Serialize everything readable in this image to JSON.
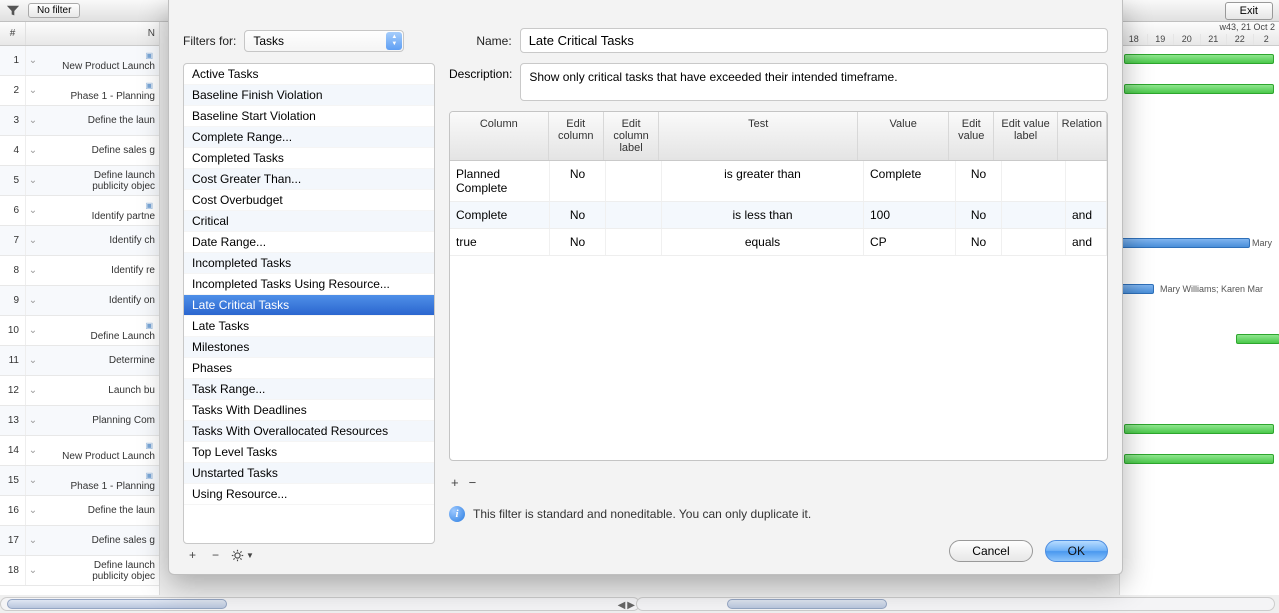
{
  "toolbar": {
    "no_filter": "No filter",
    "exit": "Exit"
  },
  "left": {
    "col_num": "#",
    "col_name": "N",
    "rows": [
      {
        "n": "1",
        "txt": "New Product Launch",
        "disc": true
      },
      {
        "n": "2",
        "txt": "Phase 1 - Planning",
        "disc": true
      },
      {
        "n": "3",
        "txt": "Define the laun"
      },
      {
        "n": "4",
        "txt": "Define sales g"
      },
      {
        "n": "5",
        "txt": "Define launch\npublicity objec"
      },
      {
        "n": "6",
        "txt": "Identify partne",
        "disc": true
      },
      {
        "n": "7",
        "txt": "Identify ch"
      },
      {
        "n": "8",
        "txt": "Identify re"
      },
      {
        "n": "9",
        "txt": "Identify on"
      },
      {
        "n": "10",
        "txt": "Define Launch",
        "disc": true
      },
      {
        "n": "11",
        "txt": "Determine"
      },
      {
        "n": "12",
        "txt": "Launch bu"
      },
      {
        "n": "13",
        "txt": "Planning Com"
      },
      {
        "n": "14",
        "txt": "New Product Launch",
        "disc": true
      },
      {
        "n": "15",
        "txt": "Phase 1 - Planning",
        "disc": true
      },
      {
        "n": "16",
        "txt": "Define the laun"
      },
      {
        "n": "17",
        "txt": "Define sales g"
      },
      {
        "n": "18",
        "txt": "Define launch\npublicity objec"
      }
    ]
  },
  "gantt": {
    "week_label": "w43, 21 Oct 2",
    "days": [
      "18",
      "19",
      "20",
      "21",
      "22",
      "2"
    ],
    "labels": [
      "Mary",
      "Mary Williams; Karen Mar"
    ]
  },
  "dialog": {
    "filters_for_label": "Filters for:",
    "filters_for_value": "Tasks",
    "name_label": "Name:",
    "name_value": "Late Critical Tasks",
    "description_label": "Description:",
    "description_value": "Show only critical tasks that have exceeded their intended timeframe.",
    "filter_list": [
      "Active Tasks",
      "Baseline Finish Violation",
      "Baseline Start Violation",
      "Complete Range...",
      "Completed Tasks",
      "Cost Greater Than...",
      "Cost Overbudget",
      "Critical",
      "Date Range...",
      "Incompleted Tasks",
      "Incompleted Tasks Using Resource...",
      "Late Critical Tasks",
      "Late Tasks",
      "Milestones",
      "Phases",
      "Task Range...",
      "Tasks With Deadlines",
      "Tasks With Overallocated Resources",
      "Top Level Tasks",
      "Unstarted Tasks",
      "Using Resource..."
    ],
    "selected_filter": "Late Critical Tasks",
    "table": {
      "headers": {
        "column": "Column",
        "edit_column": "Edit column",
        "edit_column_label": "Edit column label",
        "test": "Test",
        "value": "Value",
        "edit_value": "Edit value",
        "edit_value_label": "Edit value label",
        "relation": "Relation"
      },
      "rows": [
        {
          "column": "Planned Complete",
          "edit_column": "No",
          "edit_column_label": "",
          "test": "is greater than",
          "value": "Complete",
          "edit_value": "No",
          "edit_value_label": "",
          "relation": ""
        },
        {
          "column": "Complete",
          "edit_column": "No",
          "edit_column_label": "",
          "test": "is less than",
          "value": "100",
          "edit_value": "No",
          "edit_value_label": "",
          "relation": "and"
        },
        {
          "column": "true",
          "edit_column": "No",
          "edit_column_label": "",
          "test": "equals",
          "value": "CP",
          "edit_value": "No",
          "edit_value_label": "",
          "relation": "and"
        }
      ]
    },
    "info_text": "This filter is standard and noneditable. You can only duplicate it.",
    "buttons": {
      "cancel": "Cancel",
      "ok": "OK"
    },
    "list_toolbar": {
      "add": "+",
      "remove": "−"
    },
    "criteria_toolbar": {
      "add": "+",
      "remove": "−"
    }
  }
}
